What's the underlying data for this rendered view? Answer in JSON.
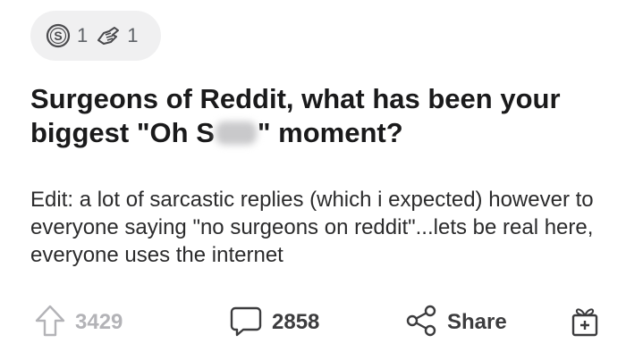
{
  "awards": [
    {
      "icon": "silver-award-icon",
      "count": "1"
    },
    {
      "icon": "helping-hand-award-icon",
      "count": "1"
    }
  ],
  "post": {
    "title_part1": "Surgeons of Reddit, what has been your biggest \"Oh S",
    "title_part2": "\" moment?",
    "body": "Edit: a lot of sarcastic replies (which i expected) however to everyone saying \"no surgeons on reddit\"...lets be real here, everyone uses the internet"
  },
  "actions": {
    "upvotes": "3429",
    "comments": "2858",
    "share_label": "Share"
  }
}
